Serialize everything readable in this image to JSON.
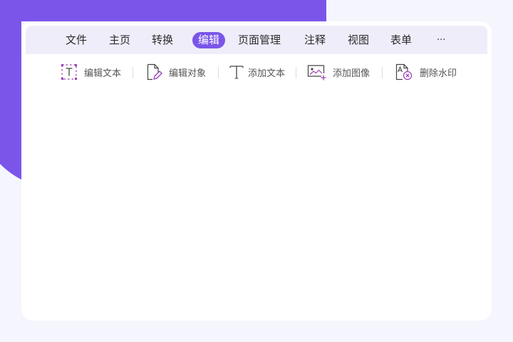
{
  "menubar": {
    "items": [
      {
        "label": "文件"
      },
      {
        "label": "主页"
      },
      {
        "label": "转换"
      },
      {
        "label": "编辑",
        "active": true
      },
      {
        "label": "页面管理"
      },
      {
        "label": "注释"
      },
      {
        "label": "视图"
      },
      {
        "label": "表单"
      },
      {
        "label": "···"
      }
    ]
  },
  "toolbar": {
    "items": [
      {
        "label": "编辑文本",
        "icon": "edit-text-icon"
      },
      {
        "label": "编辑对象",
        "icon": "edit-object-icon"
      },
      {
        "label": "添加文本",
        "icon": "add-text-icon"
      },
      {
        "label": "添加图像",
        "icon": "add-image-icon"
      },
      {
        "label": "删除水印",
        "icon": "remove-watermark-icon"
      }
    ]
  },
  "colors": {
    "accent": "#7b55ea",
    "menubar_bg": "#f0edfb",
    "page_bg": "#f5f5fd",
    "icon_purple": "#9b3fb5"
  }
}
